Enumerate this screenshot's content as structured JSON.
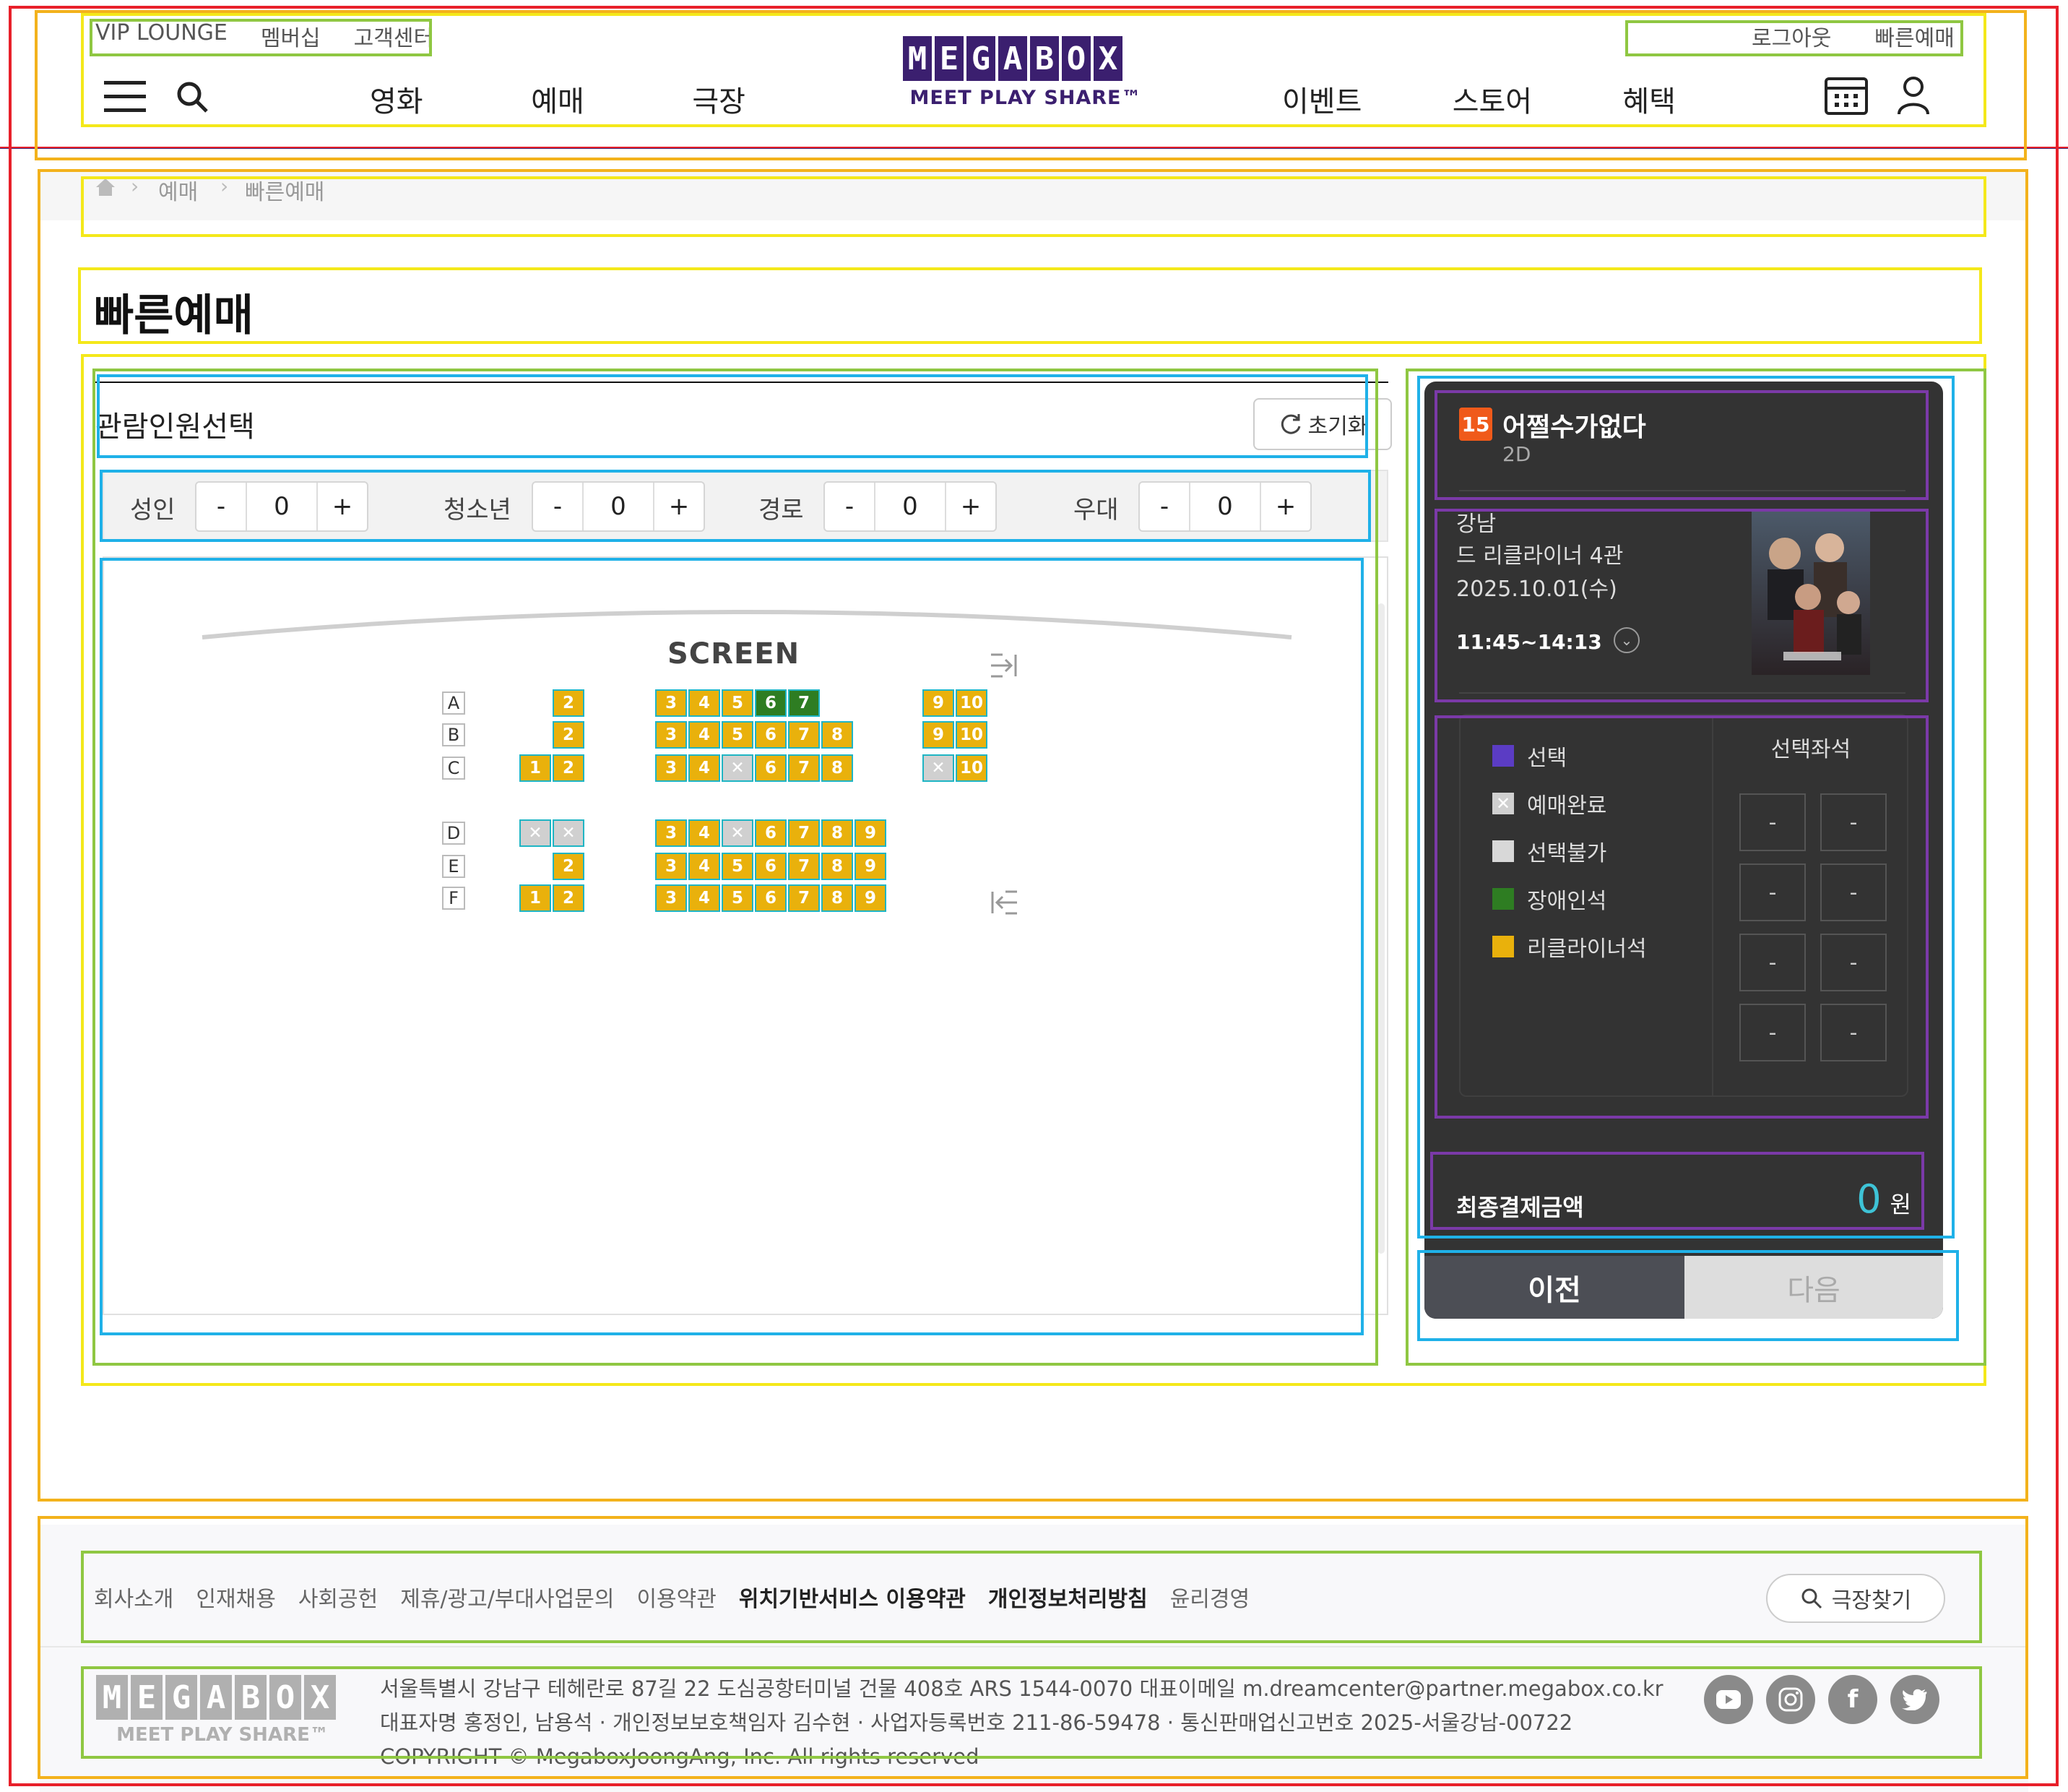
{
  "header": {
    "top_left": [
      "VIP LOUNGE",
      "멤버십",
      "고객센터"
    ],
    "top_right": [
      "로그아웃",
      "빠른예매"
    ],
    "logo_letters": [
      "M",
      "E",
      "G",
      "A",
      "B",
      "O",
      "X"
    ],
    "tagline": "MEET PLAY SHARE™",
    "nav_left": [
      "영화",
      "예매",
      "극장"
    ],
    "nav_right": [
      "이벤트",
      "스토어",
      "혜택"
    ]
  },
  "breadcrumb": [
    "예매",
    "빠른예매"
  ],
  "page_title": "빠른예매",
  "people": {
    "title": "관람인원선택",
    "reset_label": "초기화",
    "counters": [
      {
        "label": "성인",
        "value": "0"
      },
      {
        "label": "청소년",
        "value": "0"
      },
      {
        "label": "경로",
        "value": "0"
      },
      {
        "label": "우대",
        "value": "0"
      }
    ],
    "minus": "-",
    "plus": "+"
  },
  "seatmap": {
    "screen_label": "SCREEN",
    "rows": [
      "A",
      "B",
      "C",
      "D",
      "E",
      "F"
    ],
    "seats": {
      "A": [
        {
          "n": "2",
          "s": "avail"
        },
        {
          "n": "3",
          "s": "avail"
        },
        {
          "n": "4",
          "s": "avail"
        },
        {
          "n": "5",
          "s": "avail"
        },
        {
          "n": "6",
          "s": "disabled"
        },
        {
          "n": "7",
          "s": "disabled"
        },
        {
          "n": "9",
          "s": "avail"
        },
        {
          "n": "10",
          "s": "avail"
        }
      ],
      "B": [
        {
          "n": "2",
          "s": "avail"
        },
        {
          "n": "3",
          "s": "avail"
        },
        {
          "n": "4",
          "s": "avail"
        },
        {
          "n": "5",
          "s": "avail"
        },
        {
          "n": "6",
          "s": "avail"
        },
        {
          "n": "7",
          "s": "avail"
        },
        {
          "n": "8",
          "s": "avail"
        },
        {
          "n": "9",
          "s": "avail"
        },
        {
          "n": "10",
          "s": "avail"
        }
      ],
      "C": [
        {
          "n": "1",
          "s": "avail"
        },
        {
          "n": "2",
          "s": "avail"
        },
        {
          "n": "3",
          "s": "avail"
        },
        {
          "n": "4",
          "s": "avail"
        },
        {
          "n": "",
          "s": "sold"
        },
        {
          "n": "6",
          "s": "avail"
        },
        {
          "n": "7",
          "s": "avail"
        },
        {
          "n": "8",
          "s": "avail"
        },
        {
          "n": "",
          "s": "sold"
        },
        {
          "n": "10",
          "s": "avail"
        }
      ],
      "D": [
        {
          "n": "",
          "s": "sold"
        },
        {
          "n": "",
          "s": "sold"
        },
        {
          "n": "3",
          "s": "avail"
        },
        {
          "n": "4",
          "s": "avail"
        },
        {
          "n": "",
          "s": "sold"
        },
        {
          "n": "6",
          "s": "avail"
        },
        {
          "n": "7",
          "s": "avail"
        },
        {
          "n": "8",
          "s": "avail"
        },
        {
          "n": "9",
          "s": "avail"
        }
      ],
      "E": [
        {
          "n": "2",
          "s": "avail"
        },
        {
          "n": "3",
          "s": "avail"
        },
        {
          "n": "4",
          "s": "avail"
        },
        {
          "n": "5",
          "s": "avail"
        },
        {
          "n": "6",
          "s": "avail"
        },
        {
          "n": "7",
          "s": "avail"
        },
        {
          "n": "8",
          "s": "avail"
        },
        {
          "n": "9",
          "s": "avail"
        }
      ],
      "F": [
        {
          "n": "1",
          "s": "avail"
        },
        {
          "n": "2",
          "s": "avail"
        },
        {
          "n": "3",
          "s": "avail"
        },
        {
          "n": "4",
          "s": "avail"
        },
        {
          "n": "5",
          "s": "avail"
        },
        {
          "n": "6",
          "s": "avail"
        },
        {
          "n": "7",
          "s": "avail"
        },
        {
          "n": "8",
          "s": "avail"
        },
        {
          "n": "9",
          "s": "avail"
        }
      ]
    }
  },
  "summary": {
    "rating": "15",
    "movie_title": "어쩔수가없다",
    "format": "2D",
    "theater": "강남",
    "hall": "드 리클라이너 4관",
    "date": "2025.10.01(수)",
    "time": "11:45~14:13",
    "legend": [
      "선택",
      "예매완료",
      "선택불가",
      "장애인석",
      "리클라이너석"
    ],
    "legend_colors": [
      "#5b3cc4",
      "#d0d0d0",
      "#d8d8d8",
      "#2e7d22",
      "#e9b10c"
    ],
    "selected_title": "선택좌석",
    "selected_slots": [
      "-",
      "-",
      "-",
      "-",
      "-",
      "-",
      "-",
      "-"
    ],
    "total_label": "최종결제금액",
    "total_value": "0",
    "currency": "원",
    "prev_label": "이전",
    "next_label": "다음"
  },
  "footer": {
    "links": [
      "회사소개",
      "인재채용",
      "사회공헌",
      "제휴/광고/부대사업문의",
      "이용약관",
      "위치기반서비스 이용약관",
      "개인정보처리방침",
      "윤리경영"
    ],
    "find_theater": "극장찾기",
    "address_line": "서울특별시 강남구 테헤란로 87길 22 도심공항터미널 건물 408호 ARS 1544-0070 대표이메일 m.dreamcenter@partner.megabox.co.kr",
    "company_line": "대표자명 홍정인, 남용석 · 개인정보보호책임자 김수현 · 사업자등록번호 211-86-59478 · 통신판매업신고번호 2025-서울강남-00722",
    "copyright": "COPYRIGHT © MegaboxJoongAng, Inc. All rights reserved",
    "sns": [
      "youtube-icon",
      "instagram-icon",
      "facebook-icon",
      "twitter-icon"
    ]
  }
}
